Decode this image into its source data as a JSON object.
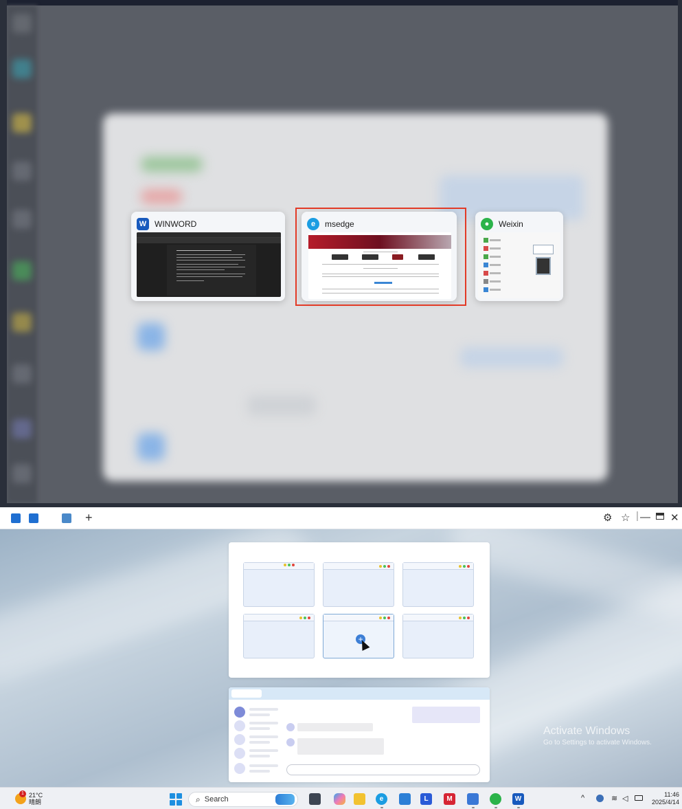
{
  "switcher": {
    "apps": [
      {
        "name": "WINWORD",
        "selected": false
      },
      {
        "name": "msedge",
        "selected": true
      },
      {
        "name": "Weixin",
        "selected": false
      }
    ]
  },
  "window": {
    "tabs": [
      {
        "icon": "layout-icon",
        "color": "#1f6fd1"
      },
      {
        "icon": "book-icon",
        "color": "#1f6fd1"
      },
      {
        "icon": "windows-stack-icon",
        "color": "#4a89c9"
      }
    ],
    "add_tab_label": "+",
    "controls": [
      "settings-icon",
      "pin-icon",
      "minimize-icon",
      "maximize-icon",
      "close-icon"
    ]
  },
  "watermark": {
    "line1": "Activate Windows",
    "line2": "Go to Settings to activate Windows."
  },
  "taskbar": {
    "weather": {
      "temp": "21°C",
      "condition": "晴朗",
      "badge": "1"
    },
    "search_label": "Search",
    "apps": [
      "task-view-icon",
      "copilot-icon",
      "file-explorer-icon",
      "edge-icon",
      "microsoft-store-icon",
      "l-app-icon",
      "mcafee-icon",
      "pc-manager-icon",
      "wechat-icon",
      "word-icon"
    ],
    "clock": {
      "time": "11:46",
      "date": "2025/4/14"
    }
  },
  "colors": {
    "accent": "#1d8fe0",
    "selection": "#e23a26",
    "word": "#185abd",
    "edge": "#1b9de2",
    "wechat": "#2bb34a"
  }
}
